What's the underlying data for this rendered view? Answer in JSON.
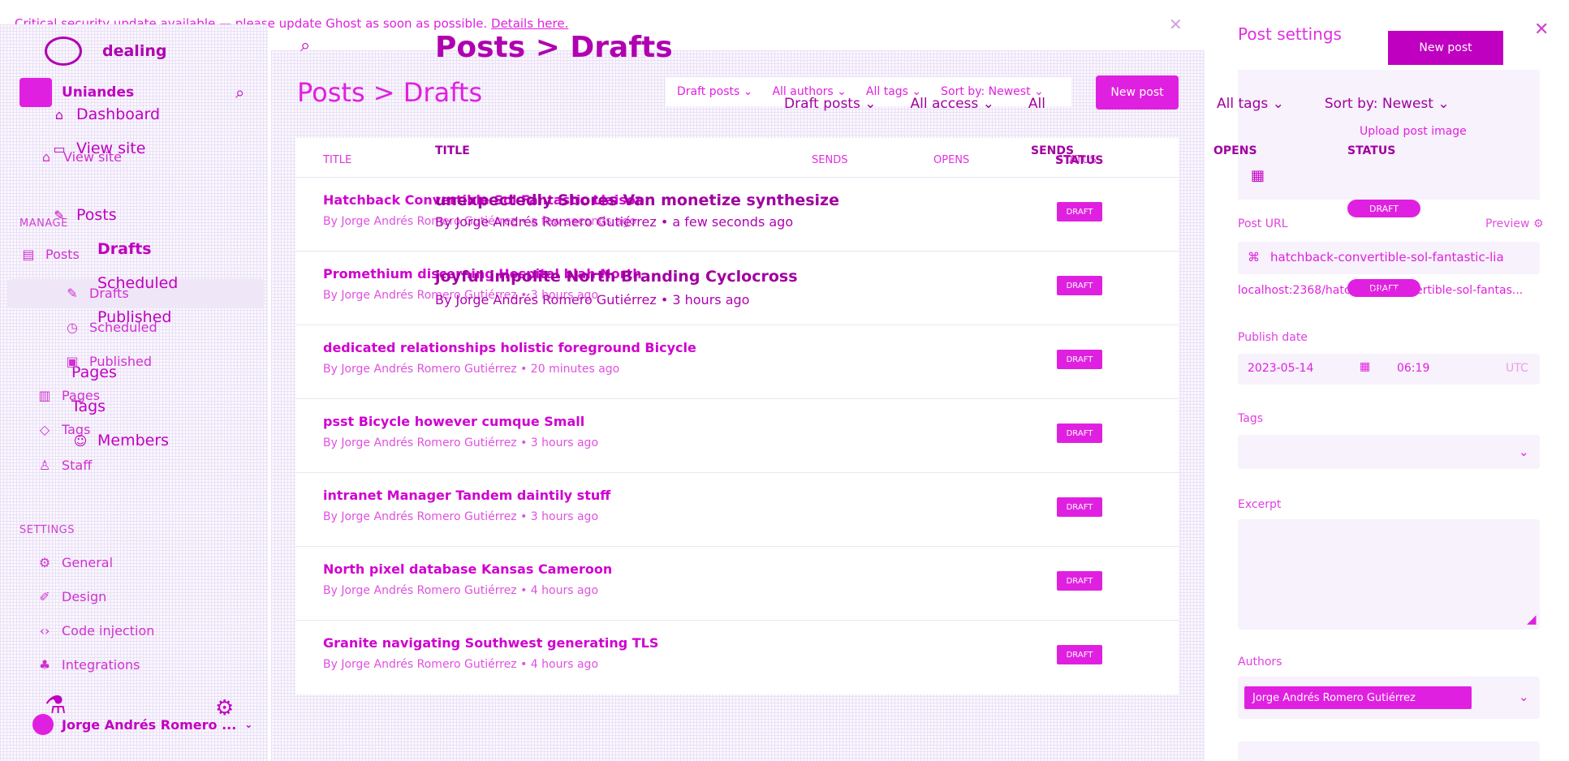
{
  "banner": {
    "text": "Critical security update available — please update Ghost as soon as possible.",
    "link": "Details here."
  },
  "nav": {
    "site_name": "dealing",
    "brand": "Uniandes",
    "items_ghost": {
      "dashboard": "Dashboard",
      "view_site": "View site",
      "posts": "Posts",
      "drafts": "Drafts",
      "scheduled": "Scheduled",
      "published": "Published",
      "pages": "Pages",
      "tags": "Tags",
      "members": "Members"
    },
    "items": {
      "view_site": "View site",
      "manage": "MANAGE",
      "posts": "Posts",
      "drafts": "Drafts",
      "scheduled": "Scheduled",
      "published": "Published",
      "pages": "Pages",
      "tags": "Tags",
      "staff": "Staff"
    },
    "settings_heading": "SETTINGS",
    "settings": {
      "general": "General",
      "design": "Design",
      "code_injection": "Code injection",
      "integrations": "Integrations"
    },
    "user_name": "Jorge Andrés Romero ..."
  },
  "main": {
    "ghost_title": "Posts > Drafts",
    "title": "Posts > Drafts",
    "filters": [
      "Draft posts",
      "All authors",
      "All tags",
      "Sort by: Newest"
    ],
    "ghost_filters": [
      "Draft posts",
      "All access",
      "All"
    ],
    "new_post": "New post",
    "columns": {
      "title": "TITLE",
      "sends": "SENDS",
      "opens": "OPENS",
      "status": "STATUS"
    },
    "ghost_columns": {
      "title": "TITLE",
      "sends": "SENDS",
      "status": "STATUS"
    },
    "rows": [
      {
        "title": "Hatchback Convertible Sol Fantastic Liaison",
        "meta": "By Jorge Andrés Romero Gutiérrez • a few seconds ago",
        "status": "DRAFT"
      },
      {
        "title": "Promethium discerning Hospital blah North",
        "meta": "By Jorge Andrés Romero Gutiérrez • 3 hours ago",
        "status": "DRAFT"
      },
      {
        "title": "dedicated relationships holistic foreground Bicycle",
        "meta": "By Jorge Andrés Romero Gutiérrez • 20 minutes ago",
        "status": "DRAFT"
      },
      {
        "title": "psst Bicycle however cumque Small",
        "meta": "By Jorge Andrés Romero Gutiérrez • 3 hours ago",
        "status": "DRAFT"
      },
      {
        "title": "intranet Manager Tandem daintily stuff",
        "meta": "By Jorge Andrés Romero Gutiérrez • 3 hours ago",
        "status": "DRAFT"
      },
      {
        "title": "North pixel database Kansas Cameroon",
        "meta": "By Jorge Andrés Romero Gutiérrez • 4 hours ago",
        "status": "DRAFT"
      },
      {
        "title": "Granite navigating Southwest generating TLS",
        "meta": "By Jorge Andrés Romero Gutiérrez • 4 hours ago",
        "status": "DRAFT"
      }
    ],
    "ghost_rows": [
      {
        "title": "unexpectedly Shores Van monetize synthesize",
        "meta": "By Jorge Andrés Romero Gutiérrez • a few seconds ago"
      },
      {
        "title": "joyful impolite North Branding Cyclocross",
        "meta": "By Jorge Andrés Romero Gutiérrez • 3 hours ago"
      }
    ]
  },
  "panel": {
    "title": "Post settings",
    "new_post": "New post",
    "ghost_filters": [
      "All tags",
      "Sort by: Newest"
    ],
    "ghost_opens": "OPENS",
    "ghost_status": "STATUS",
    "upload": "Upload post image",
    "status_pill": "DRAFT",
    "status_pill_2": "DRAFT",
    "post_url_label": "Post URL",
    "preview": "Preview",
    "post_url_value": "hatchback-convertible-sol-fantastic-lia",
    "post_url_full": "localhost:2368/hatchback-convertible-sol-fantas...",
    "publish_date_label": "Publish date",
    "publish_date": "2023-05-14",
    "publish_time": "06:19",
    "timezone": "UTC",
    "tags_label": "Tags",
    "excerpt_label": "Excerpt",
    "authors_label": "Authors",
    "author": "Jorge Andrés Romero Gutiérrez"
  }
}
